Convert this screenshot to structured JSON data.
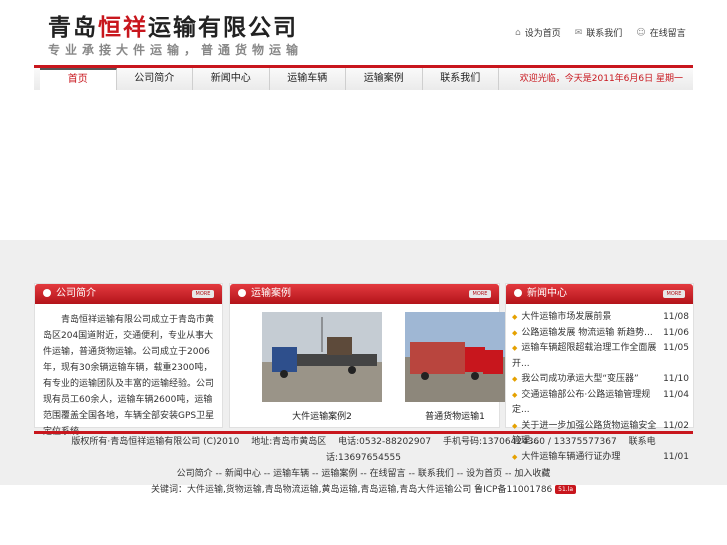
{
  "header": {
    "logo_part1": "青岛",
    "logo_part2": "恒祥",
    "logo_part3": "运输有限公司",
    "slogan": "专业承接大件运输，普通货物运输",
    "top_links": [
      "设为首页",
      "联系我们",
      "在线留言"
    ]
  },
  "nav": {
    "items": [
      "首页",
      "公司简介",
      "新闻中心",
      "运输车辆",
      "运输案例",
      "联系我们"
    ],
    "ticker": "欢迎光临，今天是2011年6月6日 星期一"
  },
  "about": {
    "title": "公司简介",
    "more": "MORE",
    "text": "青岛恒祥运输有限公司成立于青岛市黄岛区204国道附近，交通便利，专业从事大件运输，普通货物运输。公司成立于2006年，现有30余辆运输车辆，载重2300吨，有专业的运输团队及丰富的运输经验。公司现有员工60余人，运输车辆2600吨，运输范围覆盖全国各地，车辆全部安装GPS卫星定位系统..."
  },
  "cases": {
    "title": "运输案例",
    "more": "MORE",
    "captions": [
      "大件运输案例2",
      "普通货物运输1"
    ]
  },
  "news": {
    "title": "新闻中心",
    "more": "MORE",
    "items": [
      {
        "title": "大件运输市场发展前景",
        "date": "11/08"
      },
      {
        "title": "公路运输发展 物流运输 新趋势...",
        "date": "11/06"
      },
      {
        "title": "运输车辆超限超载治理工作全面展开...",
        "date": "11/05"
      },
      {
        "title": "我公司成功承运大型“变压器”",
        "date": "11/10"
      },
      {
        "title": "交通运输部公布·公路运输管理规定...",
        "date": "11/04"
      },
      {
        "title": "关于进一步加强公路货物运输安全管理...",
        "date": "11/02"
      },
      {
        "title": "大件运输车辆通行证办理",
        "date": "11/01"
      }
    ]
  },
  "footer": {
    "line1": "版权所有·青岛恒祥运输有限公司 (C)2010　 地址:青岛市黄岛区　 电话:0532-88202907　 手机号码:13706424360 / 13375577367　 联系电话:13697654555",
    "links": [
      "公司简介",
      "新闻中心",
      "运输车辆",
      "运输案例",
      "在线留言",
      "联系我们",
      "设为首页",
      "加入收藏"
    ],
    "line3": "关键词：大件运输,货物运输,青岛物流运输,黄岛运输,青岛运输,青岛大件运输公司  鲁ICP备11001786",
    "badge": "51.la"
  },
  "colors": {
    "accent": "#c8161d",
    "bullet": "#e5a100"
  }
}
